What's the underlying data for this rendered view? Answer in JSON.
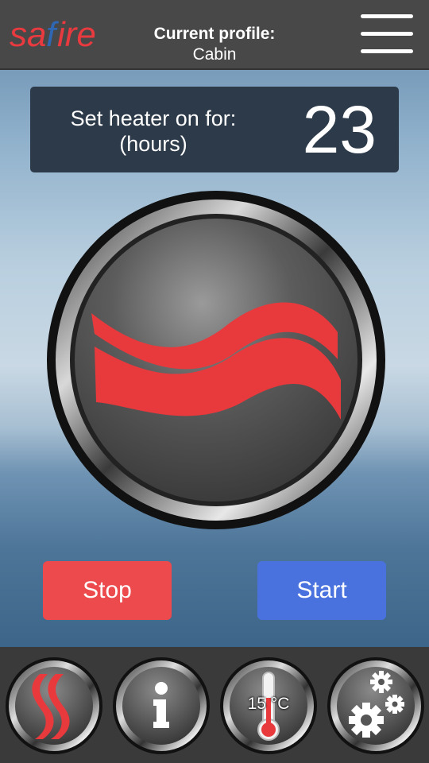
{
  "header": {
    "logo_text": "safire",
    "profile_title": "Current profile:",
    "profile_name": "Cabin"
  },
  "timer": {
    "label_line1": "Set heater on for:",
    "label_line2": "(hours)",
    "value": "23"
  },
  "actions": {
    "stop_label": "Stop",
    "start_label": "Start"
  },
  "nav": {
    "items": [
      {
        "icon": "safire-logo-icon"
      },
      {
        "icon": "info-icon",
        "glyph": "i"
      },
      {
        "icon": "thermometer-icon",
        "temperature": "15 °C"
      },
      {
        "icon": "gears-icon"
      }
    ]
  },
  "colors": {
    "brand_red": "#e93a3f",
    "brand_blue": "#2f67b3",
    "stop": "#ec4a4d",
    "start": "#4a72de",
    "timer_bg": "#2d3a4a"
  }
}
